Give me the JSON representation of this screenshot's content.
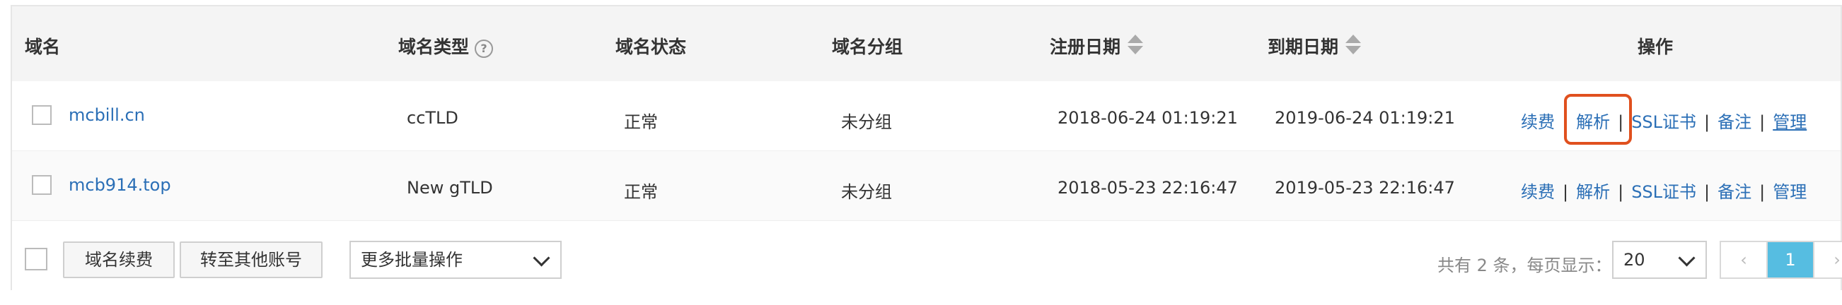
{
  "columns": {
    "domain": "域名",
    "type": "域名类型",
    "status": "域名状态",
    "group": "域名分组",
    "reg_date": "注册日期",
    "exp_date": "到期日期",
    "ops": "操作"
  },
  "rows": [
    {
      "domain": "mcbill.cn",
      "type": "ccTLD",
      "status": "正常",
      "group": "未分组",
      "reg_date": "2018-06-24 01:19:21",
      "exp_date": "2019-06-24 01:19:21",
      "ops": {
        "renew": "续费",
        "resolve": "解析",
        "ssl": "SSL证书",
        "record": "备注",
        "manage": "管理"
      },
      "resolve_highlighted": true
    },
    {
      "domain": "mcb914.top",
      "type": "New gTLD",
      "status": "正常",
      "group": "未分组",
      "reg_date": "2018-05-23 22:16:47",
      "exp_date": "2019-05-23 22:16:47",
      "ops": {
        "renew": "续费",
        "resolve": "解析",
        "ssl": "SSL证书",
        "record": "备注",
        "manage": "管理"
      },
      "resolve_highlighted": false
    }
  ],
  "footer": {
    "renew_button": "域名续费",
    "transfer_button": "转至其他账号",
    "batch_select": "更多批量操作",
    "total_text": "共有 2 条，每页显示：",
    "page_size": "20",
    "prev": "‹",
    "current_page": "1",
    "next": "›"
  },
  "help_icon_glyph": "?",
  "colors": {
    "link": "#2b6fb6",
    "highlight_border": "#e0501e",
    "active_page": "#56bde1",
    "header_bg": "#f4f4f4"
  }
}
